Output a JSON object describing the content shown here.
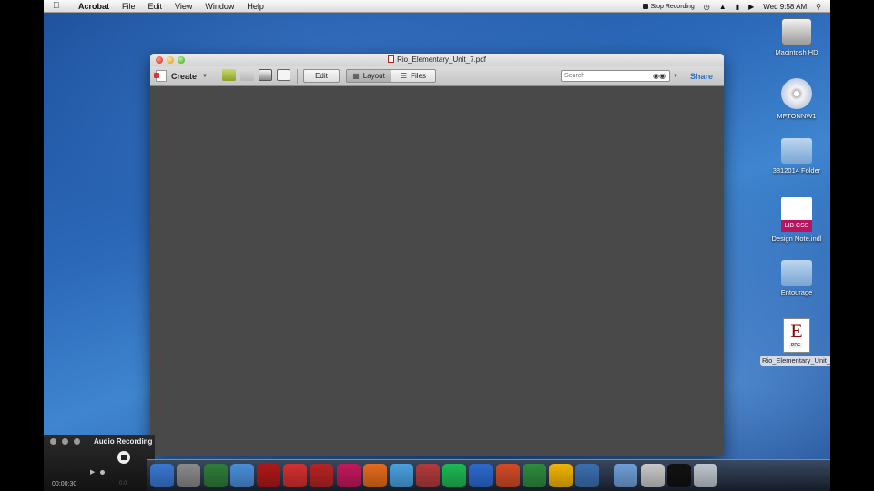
{
  "menubar": {
    "apple_icon": "apple-icon",
    "app_name": "Acrobat",
    "menus": [
      "File",
      "Edit",
      "View",
      "Window",
      "Help"
    ],
    "stop_recording": "Stop Recording",
    "clock": "Wed 9:58 AM",
    "status_icons": [
      "time-machine-icon",
      "wifi-icon",
      "battery-icon",
      "volume-icon",
      "spotlight-icon"
    ]
  },
  "window": {
    "title": "Rio_Elementary_Unit_7.pdf",
    "toolbar": {
      "create_label": "Create",
      "edit_label": "Edit",
      "layout_label": "Layout",
      "files_label": "Files",
      "search_placeholder": "Search",
      "share_label": "Share"
    }
  },
  "desktop_icons": [
    {
      "label": "Macintosh HD",
      "icon": "hard-drive-icon"
    },
    {
      "label": "MFTONNW1",
      "icon": "dvd-icon"
    },
    {
      "label": "3812014 Folder",
      "icon": "folder-icon"
    },
    {
      "label": "Design Note.indl",
      "icon": "indesign-library-icon",
      "badge": "LIB CSS"
    },
    {
      "label": "Entourage",
      "icon": "folder-icon"
    },
    {
      "label": "Rio_Elementary_Unit_7.pdf",
      "icon": "pdf-file-icon",
      "badge": "PDF",
      "letter": "E"
    }
  ],
  "audio_widget": {
    "title": "Audio Recording",
    "time": "00:00:30",
    "size": "0.0"
  },
  "dock": {
    "icons": [
      "finder-icon",
      "system-preferences-icon",
      "dreamweaver-icon",
      "itunes-icon",
      "flash-icon",
      "acrobat-icon",
      "acrobat-pro-icon",
      "indesign-icon",
      "firefox-icon",
      "ichat-icon",
      "dictionary-icon",
      "spotify-icon",
      "word-icon",
      "powerpoint-icon",
      "excel-icon",
      "outlook-icon",
      "quicktime-icon",
      "applications-folder-icon",
      "documents-icon",
      "terminal-icon",
      "trash-icon"
    ],
    "colors": [
      "#3a78d1",
      "#8a8a8a",
      "#2e7d3a",
      "#4a8fd8",
      "#b01818",
      "#d43030",
      "#b72424",
      "#c2185b",
      "#e66b1c",
      "#4aa0e0",
      "#b33b3b",
      "#1db954",
      "#2b6ad0",
      "#d24a26",
      "#2e8b3d",
      "#f0b400",
      "#3b6fb0",
      "#6f9fd8",
      "#c8c8c8",
      "#111111",
      "#bfc6cf"
    ]
  }
}
